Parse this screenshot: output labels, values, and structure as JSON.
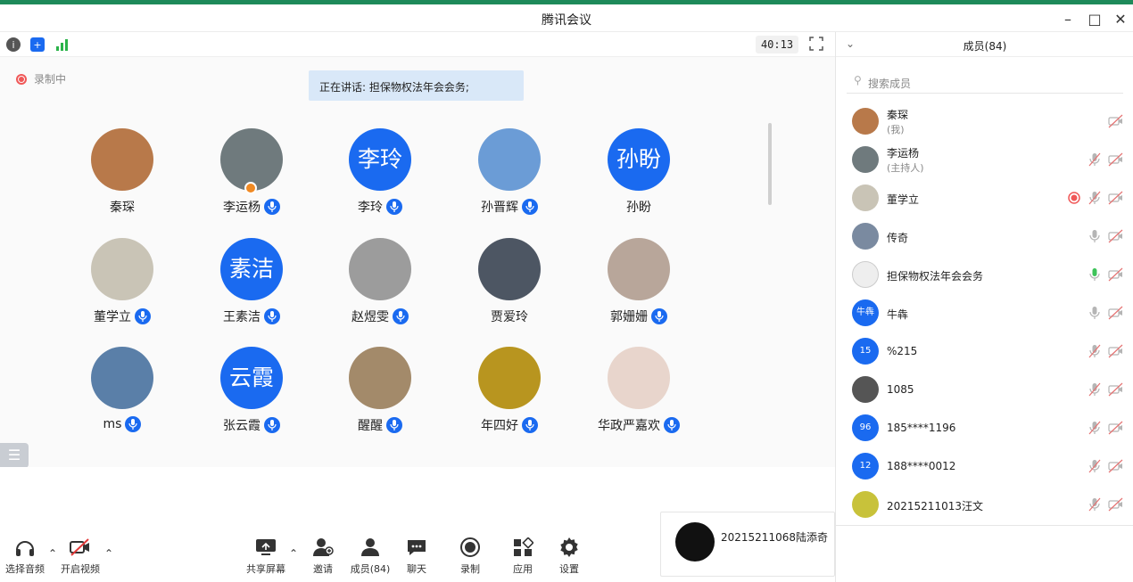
{
  "window": {
    "title": "腾讯会议"
  },
  "toolbar": {
    "timer": "40:13"
  },
  "stage": {
    "recording_label": "录制中",
    "speaking_label": "正在讲话: 担保物权法年会会务;"
  },
  "participants": [
    {
      "name": "秦琛",
      "avatar": "photo",
      "color": "#b8794a",
      "mic": false,
      "host": false
    },
    {
      "name": "李运杨",
      "avatar": "photo",
      "color": "#6f7a7d",
      "mic": true,
      "host": true
    },
    {
      "name": "李玲",
      "avatar": "text",
      "text": "李玲",
      "mic": true,
      "host": false
    },
    {
      "name": "孙晋辉",
      "avatar": "photo",
      "color": "#6b9cd6",
      "mic": true,
      "host": false
    },
    {
      "name": "孙盼",
      "avatar": "text",
      "text": "孙盼",
      "mic": false,
      "host": false
    },
    {
      "name": "董学立",
      "avatar": "photo",
      "color": "#c9c4b6",
      "mic": true,
      "host": false
    },
    {
      "name": "王素洁",
      "avatar": "text",
      "text": "素洁",
      "mic": true,
      "host": false
    },
    {
      "name": "赵煜雯",
      "avatar": "photo",
      "color": "#9c9c9c",
      "mic": true,
      "host": false
    },
    {
      "name": "贾爱玲",
      "avatar": "photo",
      "color": "#4d5663",
      "mic": false,
      "host": false
    },
    {
      "name": "郭姗姗",
      "avatar": "photo",
      "color": "#b8a69a",
      "mic": true,
      "host": false
    },
    {
      "name": "ms",
      "avatar": "photo",
      "color": "#5a7fa8",
      "mic": true,
      "host": false
    },
    {
      "name": "张云霞",
      "avatar": "text",
      "text": "云霞",
      "mic": true,
      "host": false
    },
    {
      "name": "醒醒",
      "avatar": "photo",
      "color": "#a38a6a",
      "mic": true,
      "host": false
    },
    {
      "name": "年四好",
      "avatar": "photo",
      "color": "#b8951f",
      "mic": true,
      "host": false
    },
    {
      "name": "华政严嘉欢",
      "avatar": "photo",
      "color": "#e8d5cc",
      "mic": true,
      "host": false
    }
  ],
  "bottom_bar": {
    "audio": "选择音频",
    "video": "开启视频",
    "share": "共享屏幕",
    "invite": "邀请",
    "members": "成员(84)",
    "chat": "聊天",
    "record": "录制",
    "apps": "应用",
    "settings": "设置"
  },
  "self_preview": {
    "name": "20215211068陆添奇"
  },
  "panel": {
    "title": "成员(84)",
    "search_placeholder": "搜索成员",
    "members": [
      {
        "name": "秦琛",
        "sub": "(我)",
        "avatar": "photo",
        "color": "#b8794a",
        "mic": "none",
        "cam": "off",
        "rec": false
      },
      {
        "name": "李运杨",
        "sub": "(主持人)",
        "avatar": "photo",
        "color": "#6f7a7d",
        "mic": "muted",
        "cam": "off",
        "rec": false
      },
      {
        "name": "董学立",
        "sub": "",
        "avatar": "photo",
        "color": "#c9c4b6",
        "mic": "muted",
        "cam": "off",
        "rec": true
      },
      {
        "name": "传奇",
        "sub": "",
        "avatar": "photo",
        "color": "#7a8aa0",
        "mic": "on",
        "cam": "off",
        "rec": false
      },
      {
        "name": "担保物权法年会会务",
        "sub": "",
        "avatar": "photo",
        "color": "#eeeeee",
        "mic": "active",
        "cam": "off",
        "rec": false
      },
      {
        "name": "牛犇",
        "sub": "",
        "avatar": "num",
        "label": "牛犇",
        "mic": "on",
        "cam": "off",
        "rec": false
      },
      {
        "name": "%215",
        "sub": "",
        "avatar": "num",
        "label": "15",
        "mic": "muted",
        "cam": "off",
        "rec": false
      },
      {
        "name": "1085",
        "sub": "",
        "avatar": "photo",
        "color": "#555555",
        "mic": "muted",
        "cam": "off",
        "rec": false
      },
      {
        "name": "185****1196",
        "sub": "",
        "avatar": "num",
        "label": "96",
        "mic": "muted",
        "cam": "off",
        "rec": false
      },
      {
        "name": "188****0012",
        "sub": "",
        "avatar": "num",
        "label": "12",
        "mic": "muted",
        "cam": "off",
        "rec": false
      },
      {
        "name": "20215211013汪文",
        "sub": "",
        "avatar": "photo",
        "color": "#c8c23a",
        "mic": "muted",
        "cam": "off",
        "rec": false
      }
    ]
  },
  "colors": {
    "accent": "#1a6af0",
    "record": "#f05858",
    "active_mic": "#3ec35a"
  }
}
